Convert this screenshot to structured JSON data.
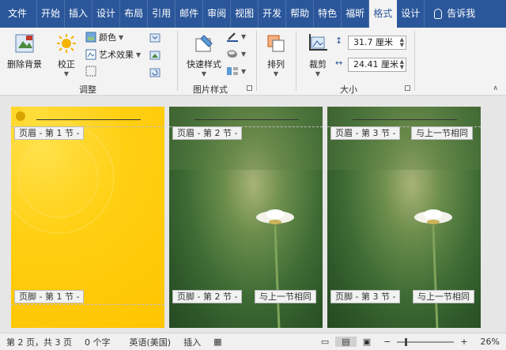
{
  "tabs": [
    "文件",
    "开始",
    "插入",
    "设计",
    "布局",
    "引用",
    "邮件",
    "审阅",
    "视图",
    "开发",
    "帮助",
    "特色",
    "福昕",
    "格式",
    "设计"
  ],
  "active_tab_index": 13,
  "tell_me": "告诉我",
  "ribbon": {
    "remove_bg": "删除背景",
    "correct": "校正",
    "color": "颜色",
    "art_effects": "艺术效果",
    "group_adjust": "调整",
    "quick_styles": "快速样式",
    "group_pic_styles": "图片样式",
    "arrange": "排列",
    "crop": "裁剪",
    "height": "31.7 厘米",
    "width": "24.41 厘米",
    "group_size": "大小"
  },
  "pages": [
    {
      "header_tag": "页眉 - 第 1 节 -",
      "footer_tag": "页脚 - 第 1 节 -",
      "same_as_prev": ""
    },
    {
      "header_tag": "页眉 - 第 2 节 -",
      "footer_tag": "页脚 - 第 2 节 -",
      "same_as_prev": "与上一节相同",
      "footer_same": "与上一节相同"
    },
    {
      "header_tag": "页眉 - 第 3 节 -",
      "footer_tag": "页脚 - 第 3 节 -",
      "same_as_prev": "与上一节相同",
      "footer_same": "与上一节相同"
    }
  ],
  "status": {
    "page": "第 2 页，共 3 页",
    "words": "0 个字",
    "lang": "英语(美国)",
    "mode": "插入",
    "zoom": "26%"
  },
  "colors": {
    "title_bar": "#2b579a",
    "ribbon_bg": "#f3f3f3",
    "page1": "#ffc400"
  }
}
